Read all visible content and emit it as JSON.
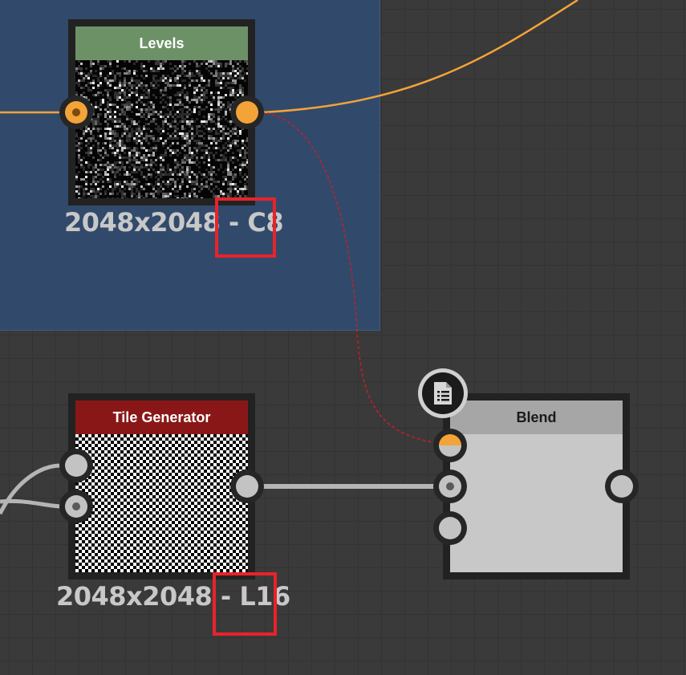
{
  "graph": {
    "frame": {
      "color": "#314a6b"
    },
    "nodes": {
      "levels": {
        "title": "Levels",
        "resolution": "2048x2048 - ",
        "format": "C8",
        "header_color": "#6d9166"
      },
      "tile_generator": {
        "title": "Tile Generator",
        "resolution": "2048x2048 - ",
        "format": "L16",
        "header_color": "#8a1717"
      },
      "blend": {
        "title": "Blend",
        "header_color": "#a6a6a6",
        "badge_icon": "document-list-icon"
      }
    },
    "wire_colors": {
      "color_wire": "#f4a338",
      "grayscale_wire": "#b5b5b5",
      "dashed_link": "#c0202a"
    },
    "highlight_color": "#e8232a"
  }
}
